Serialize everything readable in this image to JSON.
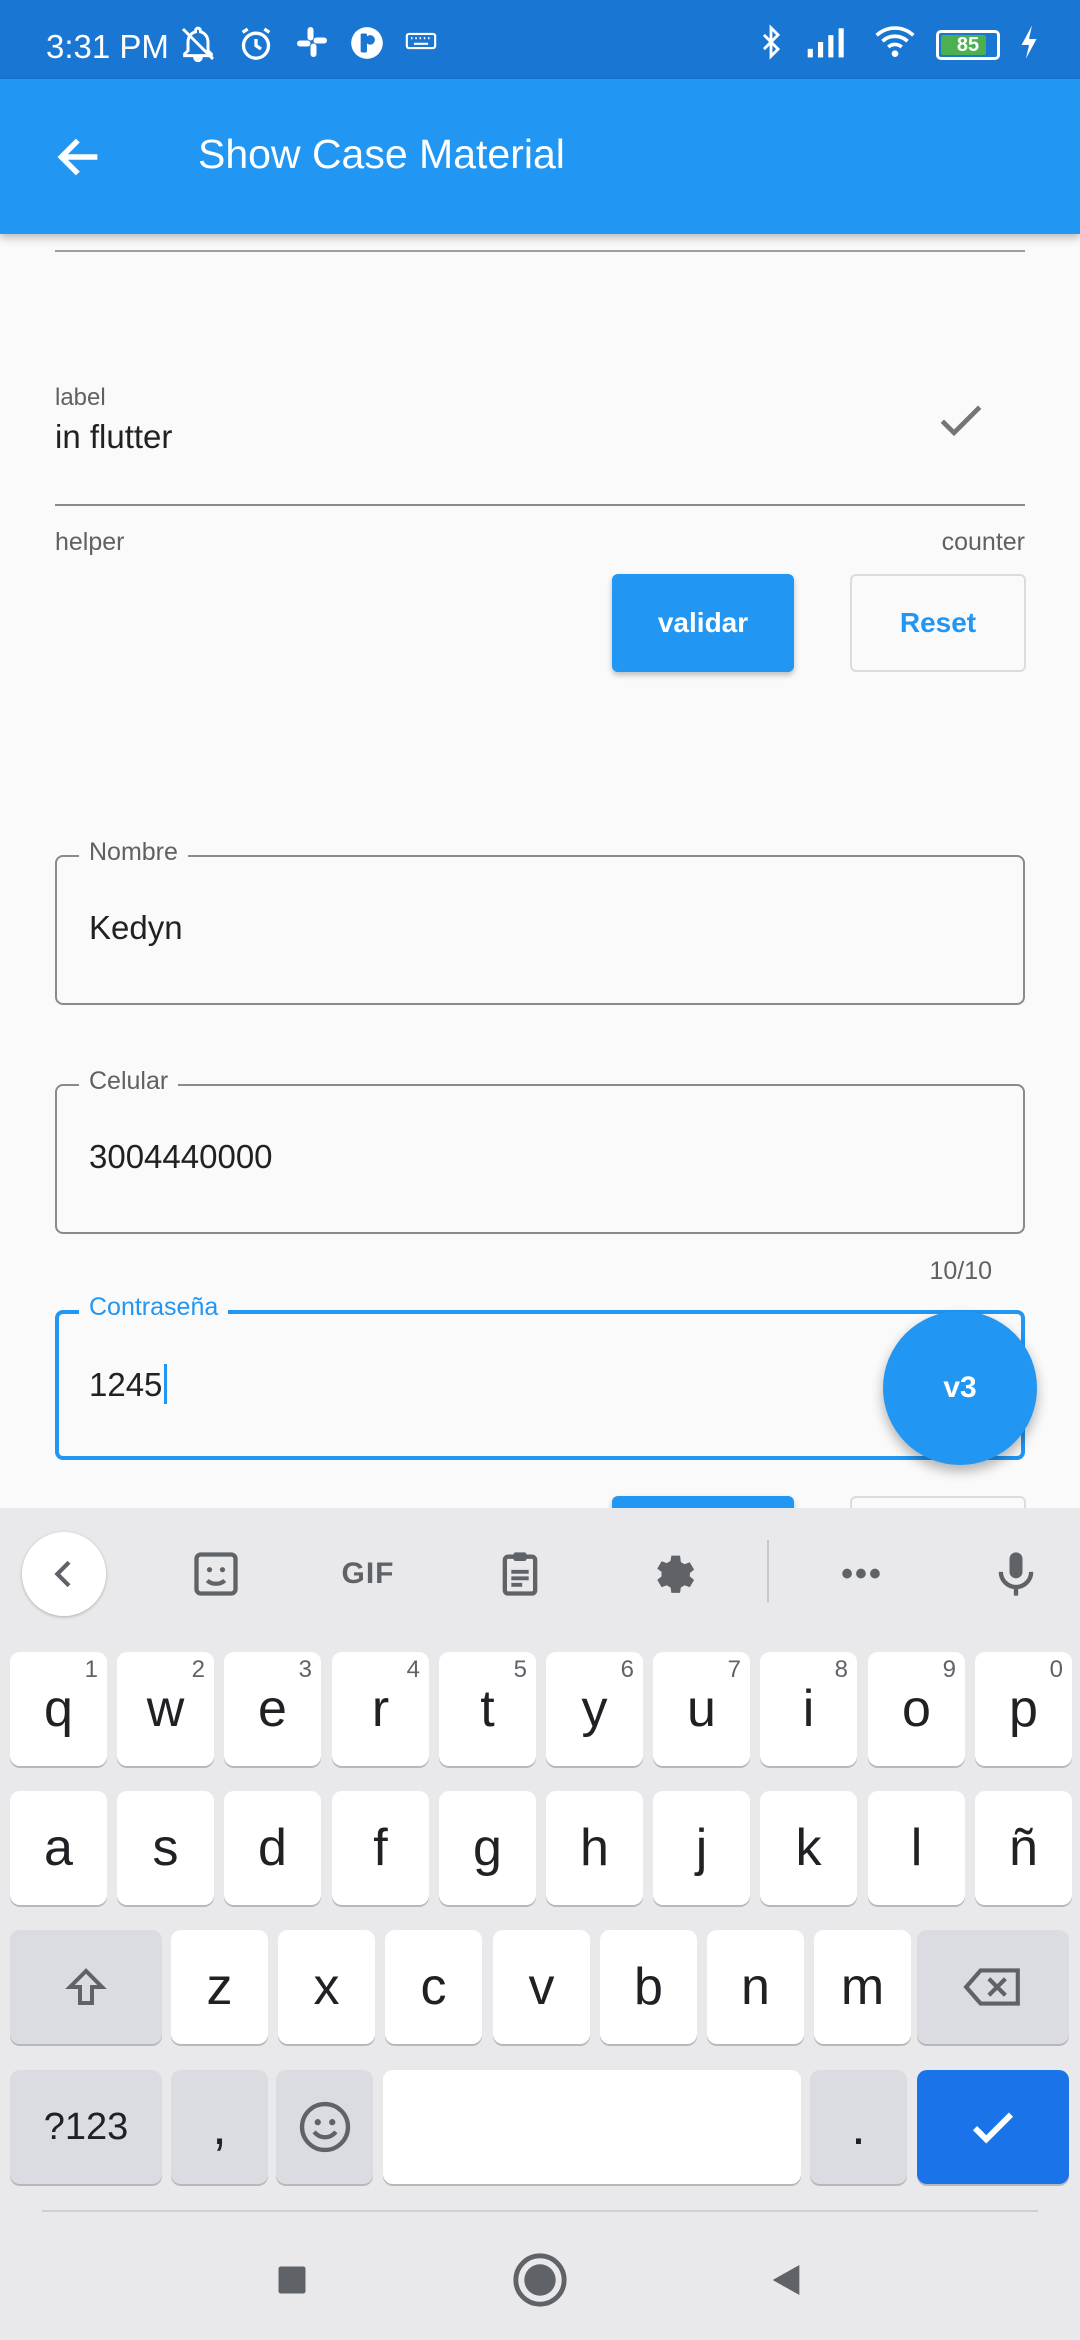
{
  "status_bar": {
    "time": "3:31 PM",
    "battery_level": "85",
    "icons_left": [
      "notifications-off-icon",
      "alarm-icon",
      "slack-icon",
      "app-icon",
      "keyboard-icon"
    ],
    "icons_right": [
      "bluetooth-icon",
      "signal-icon",
      "wifi-icon",
      "battery-icon",
      "charging-icon"
    ]
  },
  "app_bar": {
    "title": "Show Case Material",
    "back_icon": "arrow-back-icon"
  },
  "form1": {
    "label": "label",
    "value": "in flutter",
    "suffix_icon": "check-icon",
    "helper": "helper",
    "counter": "counter",
    "validate_button": "validar",
    "reset_button": "Reset"
  },
  "form2": {
    "name": {
      "label": "Nombre",
      "value": "Kedyn"
    },
    "phone": {
      "label": "Celular",
      "value": "3004440000",
      "counter": "10/10"
    },
    "password": {
      "label": "Contraseña",
      "value": "1245"
    }
  },
  "fab": {
    "label": "v3"
  },
  "colors": {
    "primary": "#2196f3",
    "status_bar": "#1976d2",
    "keyboard_bg": "#e9e9ec",
    "enter_key": "#1a73e8"
  },
  "keyboard": {
    "toolbar": [
      "chevron-left-icon",
      "sticker-icon",
      "GIF",
      "clipboard-icon",
      "settings-icon",
      "more-icon",
      "mic-icon"
    ],
    "gif_label": "GIF",
    "more_label": "•••",
    "row1": [
      {
        "key": "q",
        "hint": "1"
      },
      {
        "key": "w",
        "hint": "2"
      },
      {
        "key": "e",
        "hint": "3"
      },
      {
        "key": "r",
        "hint": "4"
      },
      {
        "key": "t",
        "hint": "5"
      },
      {
        "key": "y",
        "hint": "6"
      },
      {
        "key": "u",
        "hint": "7"
      },
      {
        "key": "i",
        "hint": "8"
      },
      {
        "key": "o",
        "hint": "9"
      },
      {
        "key": "p",
        "hint": "0"
      }
    ],
    "row2": [
      "a",
      "s",
      "d",
      "f",
      "g",
      "h",
      "j",
      "k",
      "l",
      "ñ"
    ],
    "row3": [
      "z",
      "x",
      "c",
      "v",
      "b",
      "n",
      "m"
    ],
    "symbols_key": "?123",
    "comma_key": ",",
    "period_key": "."
  },
  "nav_bar": [
    "recents-icon",
    "home-icon",
    "back-icon"
  ]
}
